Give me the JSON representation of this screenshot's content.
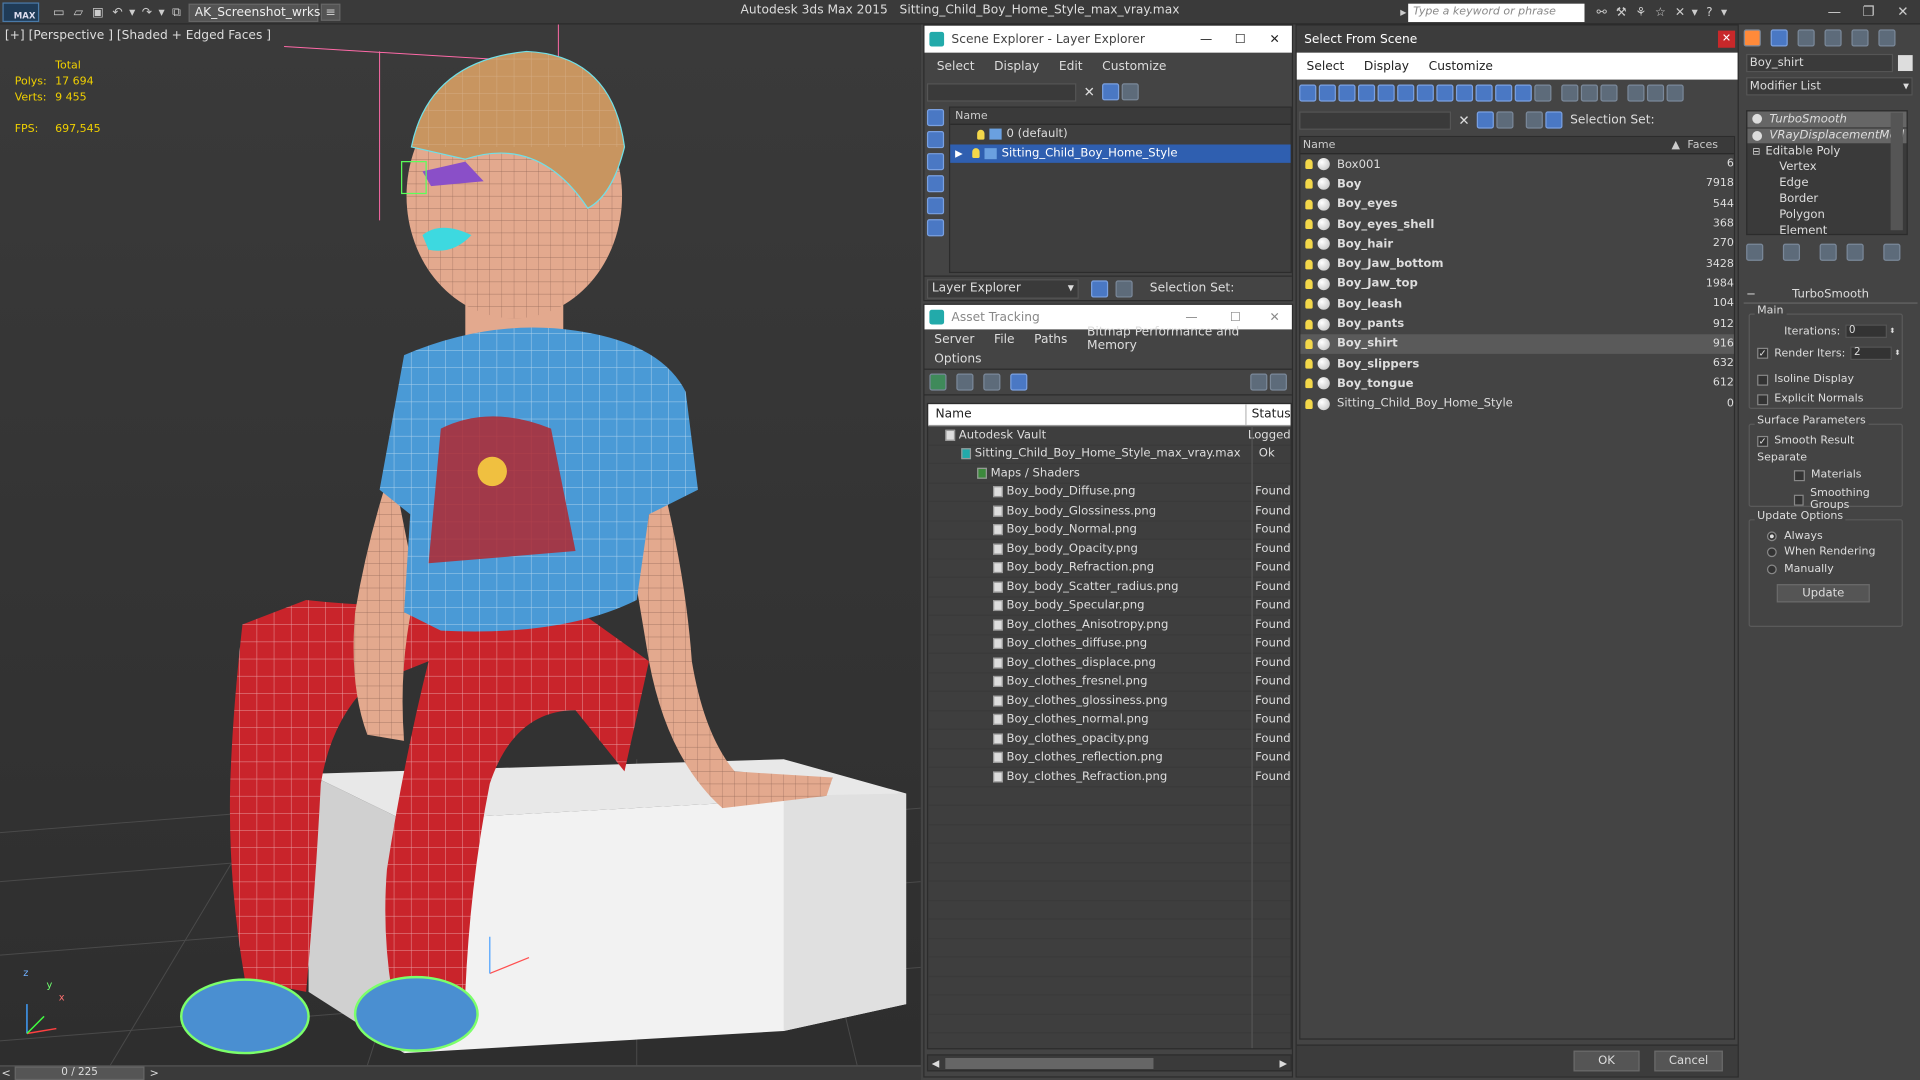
{
  "app": {
    "title": "Autodesk 3ds Max  2015",
    "file": "Sitting_Child_Boy_Home_Style_max_vray.max",
    "workspace": "AK_Screenshot_wrksp",
    "logo": "MAX",
    "search_placeholder": "Type a keyword or phrase"
  },
  "viewport": {
    "label": "[+] [Perspective ] [Shaded + Edged Faces ]",
    "total_label": "Total",
    "polys_label": "Polys:",
    "polys_value": "17 694",
    "verts_label": "Verts:",
    "verts_value": "9 455",
    "fps_label": "FPS:",
    "fps_value": "697,545",
    "timeline": "0 / 225",
    "axis_x": "x",
    "axis_y": "y",
    "axis_z": "z"
  },
  "scene_explorer": {
    "title": "Scene Explorer - Layer Explorer",
    "menu": [
      "Select",
      "Display",
      "Edit",
      "Customize"
    ],
    "col_name": "Name",
    "layers": [
      "0 (default)",
      "Sitting_Child_Boy_Home_Style"
    ],
    "footer_label": "Layer Explorer",
    "selection_set_label": "Selection Set:"
  },
  "asset_tracking": {
    "title": "Asset Tracking",
    "menu": [
      "Server",
      "File",
      "Paths",
      "Bitmap Performance and Memory"
    ],
    "menu2": "Options",
    "col_name": "Name",
    "col_status": "Status",
    "rows": [
      {
        "name": "Autodesk Vault",
        "status": "Logged",
        "indent": 0
      },
      {
        "name": "Sitting_Child_Boy_Home_Style_max_vray.max",
        "status": "Ok",
        "indent": 1
      },
      {
        "name": "Maps / Shaders",
        "status": "",
        "indent": 2
      },
      {
        "name": "Boy_body_Diffuse.png",
        "status": "Found",
        "indent": 3
      },
      {
        "name": "Boy_body_Glossiness.png",
        "status": "Found",
        "indent": 3
      },
      {
        "name": "Boy_body_Normal.png",
        "status": "Found",
        "indent": 3
      },
      {
        "name": "Boy_body_Opacity.png",
        "status": "Found",
        "indent": 3
      },
      {
        "name": "Boy_body_Refraction.png",
        "status": "Found",
        "indent": 3
      },
      {
        "name": "Boy_body_Scatter_radius.png",
        "status": "Found",
        "indent": 3
      },
      {
        "name": "Boy_body_Specular.png",
        "status": "Found",
        "indent": 3
      },
      {
        "name": "Boy_clothes_Anisotropy.png",
        "status": "Found",
        "indent": 3
      },
      {
        "name": "Boy_clothes_diffuse.png",
        "status": "Found",
        "indent": 3
      },
      {
        "name": "Boy_clothes_displace.png",
        "status": "Found",
        "indent": 3
      },
      {
        "name": "Boy_clothes_fresnel.png",
        "status": "Found",
        "indent": 3
      },
      {
        "name": "Boy_clothes_glossiness.png",
        "status": "Found",
        "indent": 3
      },
      {
        "name": "Boy_clothes_normal.png",
        "status": "Found",
        "indent": 3
      },
      {
        "name": "Boy_clothes_opacity.png",
        "status": "Found",
        "indent": 3
      },
      {
        "name": "Boy_clothes_reflection.png",
        "status": "Found",
        "indent": 3
      },
      {
        "name": "Boy_clothes_Refraction.png",
        "status": "Found",
        "indent": 3
      }
    ]
  },
  "select_from_scene": {
    "title": "Select From Scene",
    "menu": [
      "Select",
      "Display",
      "Customize"
    ],
    "selection_set_label": "Selection Set:",
    "col_name": "Name",
    "col_faces": "Faces",
    "objects": [
      {
        "name": "Box001",
        "faces": "6",
        "bold": false
      },
      {
        "name": "Boy",
        "faces": "7918",
        "bold": true
      },
      {
        "name": "Boy_eyes",
        "faces": "544",
        "bold": true
      },
      {
        "name": "Boy_eyes_shell",
        "faces": "368",
        "bold": true
      },
      {
        "name": "Boy_hair",
        "faces": "270",
        "bold": true
      },
      {
        "name": "Boy_Jaw_bottom",
        "faces": "3428",
        "bold": true
      },
      {
        "name": "Boy_Jaw_top",
        "faces": "1984",
        "bold": true
      },
      {
        "name": "Boy_leash",
        "faces": "104",
        "bold": true
      },
      {
        "name": "Boy_pants",
        "faces": "912",
        "bold": true
      },
      {
        "name": "Boy_shirt",
        "faces": "916",
        "bold": true
      },
      {
        "name": "Boy_slippers",
        "faces": "632",
        "bold": true
      },
      {
        "name": "Boy_tongue",
        "faces": "612",
        "bold": true
      },
      {
        "name": "Sitting_Child_Boy_Home_Style",
        "faces": "0",
        "bold": false
      }
    ],
    "ok": "OK",
    "cancel": "Cancel"
  },
  "modify_panel": {
    "object_name": "Boy_shirt",
    "modifier_list": "Modifier List",
    "stack": [
      "TurboSmooth",
      "VRayDisplacementMod",
      "Editable Poly",
      "Vertex",
      "Edge",
      "Border",
      "Polygon",
      "Element"
    ],
    "rollout_title": "TurboSmooth",
    "main_label": "Main",
    "iterations_label": "Iterations:",
    "iterations_value": "0",
    "render_iters_label": "Render Iters:",
    "render_iters_value": "2",
    "isoline_label": "Isoline Display",
    "explicit_normals_label": "Explicit Normals",
    "surface_params_label": "Surface Parameters",
    "smooth_result_label": "Smooth Result",
    "separate_label": "Separate",
    "materials_label": "Materials",
    "smoothing_groups_label": "Smoothing Groups",
    "update_options_label": "Update Options",
    "always_label": "Always",
    "when_rendering_label": "When Rendering",
    "manually_label": "Manually",
    "update_button": "Update"
  }
}
